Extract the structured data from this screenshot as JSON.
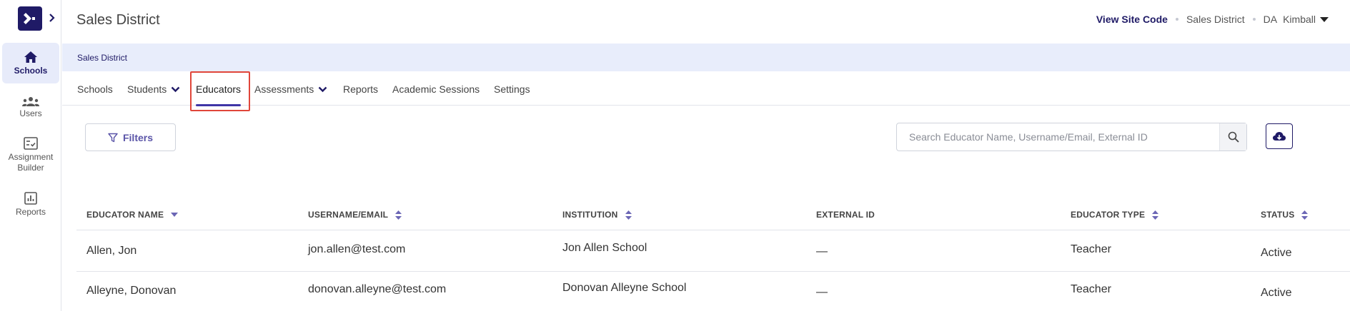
{
  "header": {
    "title": "Sales District",
    "view_site_code": "View Site Code",
    "district": "Sales District",
    "user_initials": "DA",
    "user_name": "Kimball"
  },
  "sidebar": {
    "items": [
      {
        "label": "Schools",
        "icon": "home-icon",
        "active": true
      },
      {
        "label": "Users",
        "icon": "users-icon",
        "active": false
      },
      {
        "label": "Assignment Builder",
        "icon": "assignment-builder-icon",
        "active": false
      },
      {
        "label": "Reports",
        "icon": "bar-chart-icon",
        "active": false
      }
    ]
  },
  "breadcrumb": "Sales District",
  "tabs": [
    {
      "label": "Schools"
    },
    {
      "label": "Students",
      "dropdown": true
    },
    {
      "label": "Educators",
      "active": true
    },
    {
      "label": "Assessments",
      "dropdown": true
    },
    {
      "label": "Reports"
    },
    {
      "label": "Academic Sessions"
    },
    {
      "label": "Settings"
    }
  ],
  "filters_label": "Filters",
  "search": {
    "placeholder": "Search Educator Name, Username/Email, External ID",
    "value": ""
  },
  "table": {
    "columns": [
      {
        "label": "EDUCATOR NAME",
        "sort": "desc"
      },
      {
        "label": "USERNAME/EMAIL",
        "sort": "both"
      },
      {
        "label": "INSTITUTION",
        "sort": "both"
      },
      {
        "label": "EXTERNAL ID",
        "sort": "none"
      },
      {
        "label": "EDUCATOR TYPE",
        "sort": "both"
      },
      {
        "label": "STATUS",
        "sort": "both"
      }
    ],
    "rows": [
      {
        "name": "Allen, Jon",
        "email": "jon.allen@test.com",
        "institution": "Jon Allen School",
        "external_id": "—",
        "type": "Teacher",
        "status": "Active"
      },
      {
        "name": "Alleyne, Donovan",
        "email": "donovan.alleyne@test.com",
        "institution": "Donovan Alleyne School",
        "external_id": "—",
        "type": "Teacher",
        "status": "Active"
      }
    ]
  },
  "colors": {
    "brand": "#1f1a66",
    "accent": "#3f35a6",
    "breadcrumb_band": "#e8edfb",
    "highlight": "#e0463a"
  }
}
